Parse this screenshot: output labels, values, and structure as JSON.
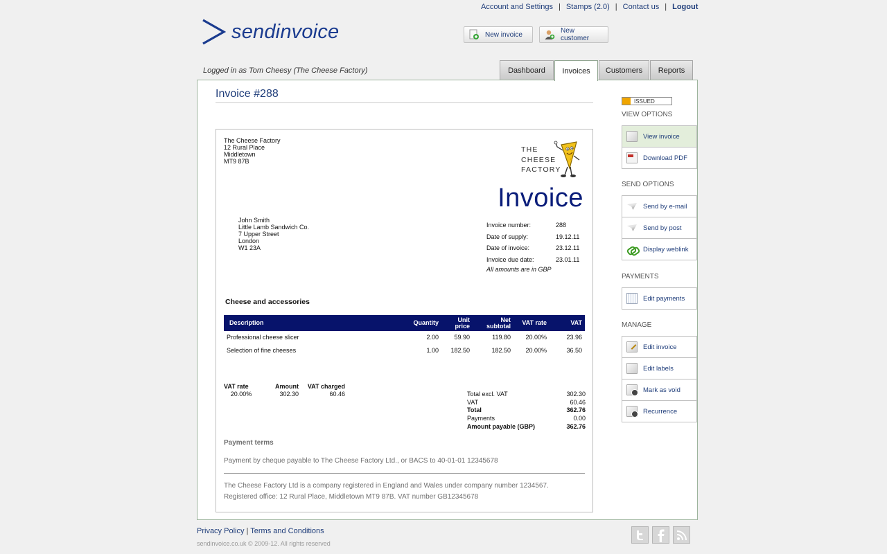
{
  "header": {
    "links": [
      "Account and Settings",
      "Stamps (2.0)",
      "Contact us"
    ],
    "logout": "Logout",
    "logo_text": "sendinvoice",
    "new_invoice": "New invoice",
    "new_customer": "New customer",
    "logged_in": "Logged in as Tom Cheesy (The Cheese Factory)",
    "tabs": [
      "Dashboard",
      "Invoices",
      "Customers",
      "Reports"
    ],
    "active_tab": "Invoices"
  },
  "page_title": "Invoice #288",
  "invoice": {
    "sender": [
      "The Cheese Factory",
      "12 Rural Place",
      "Middletown",
      "MT9 87B"
    ],
    "brand_lines": [
      "THE",
      "CHEESE",
      "FACTORY"
    ],
    "big_title": "Invoice",
    "recipient": [
      "John Smith",
      "Little Lamb Sandwich Co.",
      "7 Upper Street",
      "London",
      "W1 23A"
    ],
    "meta": [
      {
        "label": "Invoice number:",
        "value": "288"
      },
      {
        "label": "Date of supply:",
        "value": "19.12.11"
      },
      {
        "label": "Date of invoice:",
        "value": "23.12.11"
      },
      {
        "label": "Invoice due date:",
        "value": "23.01.11"
      }
    ],
    "amounts_note": "All amounts are in GBP",
    "section_title": "Cheese and accessories",
    "columns": [
      "Description",
      "Quantity",
      "Unit price",
      "Net subtotal",
      "VAT rate",
      "VAT"
    ],
    "items": [
      [
        "Professional cheese slicer",
        "2.00",
        "59.90",
        "119.80",
        "20.00%",
        "23.96"
      ],
      [
        "Selection of fine cheeses",
        "1.00",
        "182.50",
        "182.50",
        "20.00%",
        "36.50"
      ]
    ],
    "vat_summary": {
      "headers": [
        "VAT rate",
        "Amount",
        "VAT charged"
      ],
      "row": [
        "20.00%",
        "302.30",
        "60.46"
      ]
    },
    "totals": [
      {
        "label": "Total excl. VAT",
        "value": "302.30"
      },
      {
        "label": "VAT",
        "value": "60.46"
      },
      {
        "label": "Total",
        "value": "362.76"
      },
      {
        "label": "Payments",
        "value": "0.00"
      },
      {
        "label": "Amount payable (GBP)",
        "value": "362.76"
      }
    ],
    "payment_terms_title": "Payment terms",
    "payment_terms_text": "Payment by cheque payable to The Cheese Factory Ltd., or BACS to 40-01-01 12345678",
    "footer_lines": [
      "The Cheese Factory Ltd is a company registered in England and Wales under company number 1234567.",
      "Registered office: 12 Rural Place, Middletown MT9 87B. VAT number GB12345678"
    ]
  },
  "sidebar": {
    "status": "ISSUED",
    "status_color": "#f0a500",
    "sections": [
      {
        "title": "VIEW OPTIONS",
        "items": [
          {
            "label": "View invoice",
            "icon": "document-icon"
          },
          {
            "label": "Download PDF",
            "icon": "pdf-icon"
          }
        ]
      },
      {
        "title": "SEND OPTIONS",
        "items": [
          {
            "label": "Send by e-mail",
            "icon": "paper-plane-icon"
          },
          {
            "label": "Send by post",
            "icon": "paper-plane-icon"
          },
          {
            "label": "Display weblink",
            "icon": "link-icon"
          }
        ]
      },
      {
        "title": "PAYMENTS",
        "items": [
          {
            "label": "Edit payments",
            "icon": "calculator-icon"
          }
        ]
      },
      {
        "title": "MANAGE",
        "items": [
          {
            "label": "Edit invoice",
            "icon": "edit-document-icon"
          },
          {
            "label": "Edit labels",
            "icon": "label-document-icon"
          },
          {
            "label": "Mark as void",
            "icon": "void-document-icon"
          },
          {
            "label": "Recurrence",
            "icon": "recurrence-document-icon"
          }
        ]
      }
    ]
  },
  "footer": {
    "privacy": "Privacy Policy",
    "separator": "|",
    "terms": "Terms and Conditions",
    "copyright": "sendinvoice.co.uk © 2009-12. All rights reserved"
  },
  "colors": {
    "brand_blue": "#1a3b8f",
    "table_header": "#07136b",
    "panel_border": "#9db49d",
    "selected_item": "#e3eedb"
  }
}
